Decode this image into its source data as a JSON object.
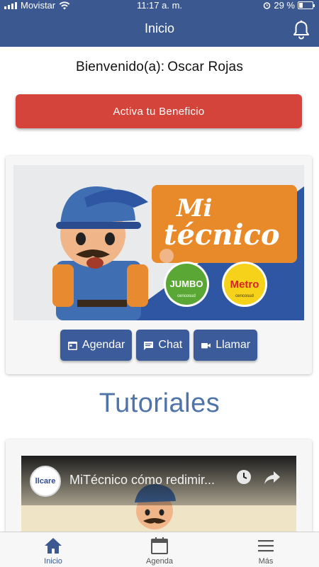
{
  "status_bar": {
    "carrier": "Movistar",
    "time": "11:17 a. m.",
    "battery": "29 %",
    "battery_level": 0.29
  },
  "header": {
    "title": "Inicio",
    "bell_icon": "bell-icon"
  },
  "welcome": {
    "prefix": "Bienvenido(a):",
    "name": "Oscar Rojas"
  },
  "cta": {
    "label": "Activa tu Beneficio"
  },
  "banner": {
    "logo_line1": "Mi",
    "logo_line2": "técnico",
    "brand1": "JUMBO",
    "brand1_sub": "cencosud",
    "brand2": "Metro",
    "brand2_sub": "cencosud"
  },
  "actions": [
    {
      "label": "Agendar",
      "icon": "calendar-icon"
    },
    {
      "label": "Chat",
      "icon": "chat-icon"
    },
    {
      "label": "Llamar",
      "icon": "video-camera-icon"
    }
  ],
  "tutorials": {
    "heading": "Tutoriales",
    "video_title": "MiTécnico cómo redimir...",
    "channel_logo": "llcare"
  },
  "tabbar": [
    {
      "label": "Inicio",
      "icon": "home-icon",
      "active": true
    },
    {
      "label": "Agenda",
      "icon": "calendar-icon",
      "active": false
    },
    {
      "label": "Más",
      "icon": "menu-icon",
      "active": false
    }
  ],
  "colors": {
    "nav": "#3b5990",
    "cta": "#d5443b",
    "button": "#3b5b9b",
    "heading": "#4f74aa"
  }
}
